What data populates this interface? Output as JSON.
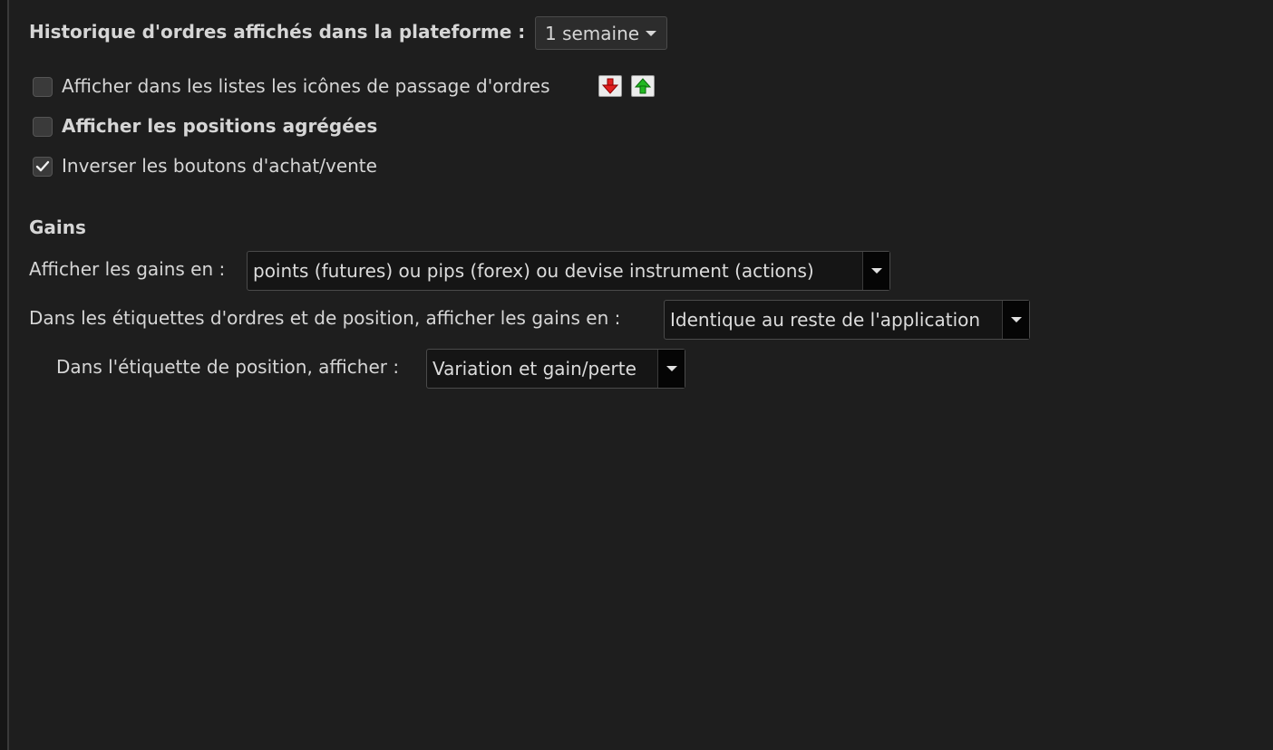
{
  "history": {
    "label": "Historique d'ordres affichés dans la plateforme :",
    "selected": "1 semaine"
  },
  "options": {
    "order_icons": {
      "label": "Afficher dans les listes les icônes de passage d'ordres",
      "checked": false
    },
    "aggregated_positions": {
      "label": "Afficher les positions agrégées",
      "checked": false
    },
    "invert_buttons": {
      "label": "Inverser les boutons d'achat/vente",
      "checked": true
    }
  },
  "order_icons": {
    "sell": {
      "icon": "sell-order-icon",
      "color": "#e02020"
    },
    "buy": {
      "icon": "buy-order-icon",
      "color": "#22b822"
    }
  },
  "gains": {
    "section_title": "Gains",
    "display_in": {
      "label": "Afficher les gains en :",
      "value": "points (futures) ou pips (forex) ou devise instrument (actions)"
    },
    "labels_display": {
      "label": "Dans les étiquettes d'ordres et de position, afficher les gains en :",
      "value": "Identique au reste de l'application"
    },
    "position_label": {
      "label": "Dans l'étiquette de position, afficher :",
      "value": "Variation et gain/perte"
    }
  }
}
